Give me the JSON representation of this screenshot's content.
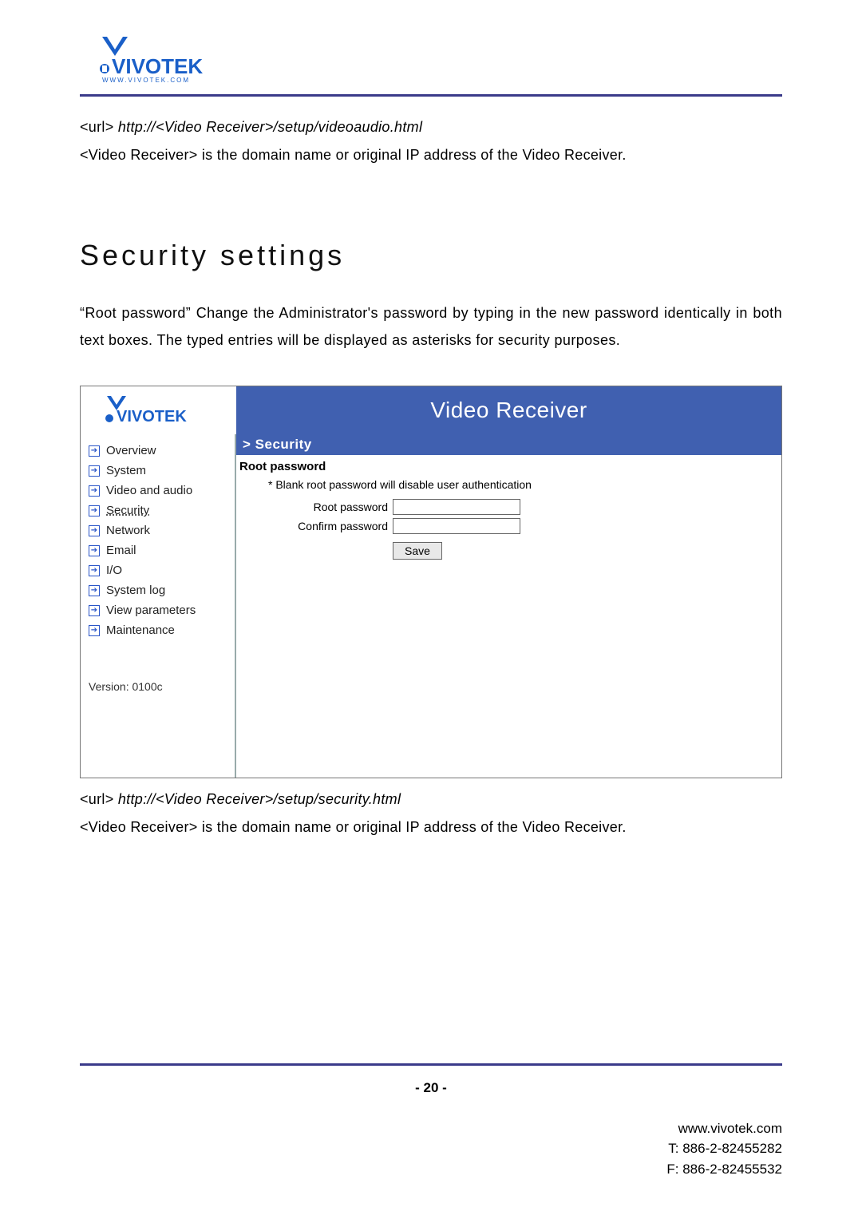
{
  "url_top": {
    "label": "<url>",
    "path": "http://<Video Receiver>/setup/videoaudio.html"
  },
  "desc_top": "<Video Receiver> is the domain name or original IP address of the Video Receiver.",
  "section_heading": "Security settings",
  "section_body": "“Root password” Change the Administrator's password by typing in the new password identically in both text boxes. The typed entries will be displayed as asterisks for security purposes.",
  "ui": {
    "header_title": "Video Receiver",
    "breadcrumb": "> Security",
    "panel_title": "Root password",
    "hint": "* Blank root password will disable user authentication",
    "root_label": "Root password",
    "confirm_label": "Confirm password",
    "save_label": "Save",
    "nav": [
      {
        "label": "Overview",
        "active": false
      },
      {
        "label": "System",
        "active": false
      },
      {
        "label": "Video and audio",
        "active": false
      },
      {
        "label": "Security",
        "active": true
      },
      {
        "label": "Network",
        "active": false
      },
      {
        "label": "Email",
        "active": false
      },
      {
        "label": "I/O",
        "active": false
      },
      {
        "label": "System log",
        "active": false
      },
      {
        "label": "View parameters",
        "active": false
      },
      {
        "label": "Maintenance",
        "active": false
      }
    ],
    "version": "Version: 0100c"
  },
  "url_bottom": {
    "label": "<url>",
    "path": "http://<Video Receiver>/setup/security.html"
  },
  "desc_bottom": "<Video Receiver> is the domain name or original IP address of the Video Receiver.",
  "footer": {
    "page": "- 20 -",
    "website": "www.vivotek.com",
    "tel": "T: 886-2-82455282",
    "fax": "F: 886-2-82455532"
  }
}
